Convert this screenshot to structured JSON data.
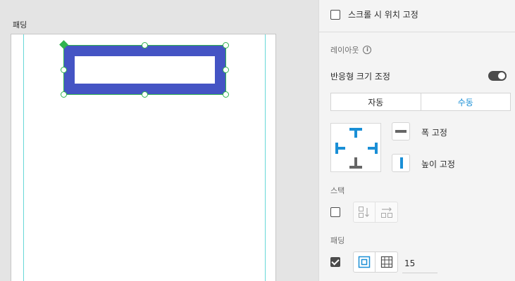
{
  "canvas": {
    "artboard_label": "패딩"
  },
  "panel": {
    "scroll_fix_label": "스크롤 시 위치 고정",
    "layout_title": "레이아웃",
    "info_icon": "info-icon",
    "responsive_resize_label": "반응형 크기 조정",
    "responsive_resize_on": true,
    "resize_modes": [
      "자동",
      "수동"
    ],
    "resize_mode_selected": "수동",
    "fix_width_label": "폭 고정",
    "fix_height_label": "높이 고정",
    "stack_title": "스택",
    "padding_title": "패딩",
    "padding_value": "15",
    "accent_color": "#1a8fd6",
    "selection_color": "#2fb34f",
    "shape_fill": "#4454c4"
  }
}
